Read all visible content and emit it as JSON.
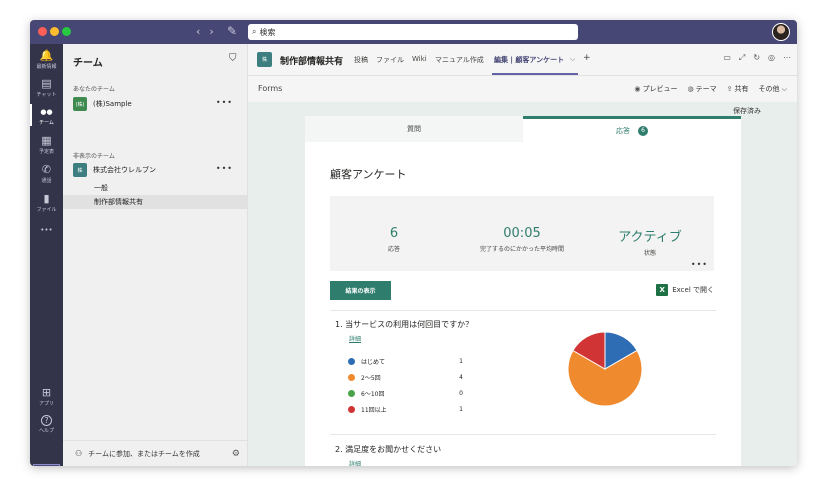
{
  "titlebar": {
    "search_text": "検索",
    "nav_back": "‹",
    "nav_forward": "›",
    "compose_icon": "✎"
  },
  "rail": [
    {
      "label": "最新情報",
      "icon": "bell-icon",
      "glyph": "🔔"
    },
    {
      "label": "チャット",
      "icon": "chat-icon",
      "glyph": "▤"
    },
    {
      "label": "チーム",
      "icon": "teams-icon",
      "glyph": "●●",
      "active": true
    },
    {
      "label": "予定表",
      "icon": "calendar-icon",
      "glyph": "▦"
    },
    {
      "label": "通話",
      "icon": "phone-icon",
      "glyph": "✆"
    },
    {
      "label": "ファイル",
      "icon": "file-icon",
      "glyph": "▮"
    },
    {
      "label": "",
      "icon": "more-icon",
      "glyph": "•••"
    },
    {
      "label": "アプリ",
      "icon": "apps-icon",
      "glyph": "⊞"
    },
    {
      "label": "ヘルプ",
      "icon": "help-icon",
      "glyph": "?"
    }
  ],
  "teams_panel": {
    "title": "チーム",
    "section_your_teams": "あなたのチーム",
    "section_hidden": "非表示のチーム",
    "teams": [
      {
        "logo_text": "(株)",
        "name": "(株)Sample",
        "color": "#3f8b4f"
      },
      {
        "logo_text": "株",
        "name": "株式会社ウレルブン",
        "color": "#3d7f80"
      }
    ],
    "channels": [
      {
        "name": "一般",
        "active": false
      },
      {
        "name": "制作部情報共有",
        "active": true
      }
    ],
    "join_text": "チームに参加、またはチームを作成"
  },
  "channel_header": {
    "logo_text": "株",
    "name": "制作部情報共有",
    "tabs": [
      "投稿",
      "ファイル",
      "Wiki",
      "マニュアル作成",
      "編集 | 顧客アンケート"
    ],
    "active_tab_index": 4,
    "add_tab": "+"
  },
  "forms_bar": {
    "label": "Forms",
    "actions": [
      {
        "icon": "eye-icon",
        "glyph": "◉",
        "label": "プレビュー"
      },
      {
        "icon": "palette-icon",
        "glyph": "◍",
        "label": "テーマ"
      },
      {
        "icon": "share-icon",
        "glyph": "⇪",
        "label": "共有"
      },
      {
        "icon": "chevron-down-icon",
        "glyph": "",
        "label": "その他 ⌵"
      }
    ],
    "saved_text": "保存済み"
  },
  "form": {
    "tab_questions": "質問",
    "tab_responses": "応答",
    "responses_badge": "6",
    "title": "顧客アンケート",
    "stats": [
      {
        "value": "6",
        "label": "応答"
      },
      {
        "value": "00:05",
        "label": "完了するのにかかった平均時間"
      },
      {
        "value": "アクティブ",
        "label": "状態"
      }
    ],
    "results_button": "結果の表示",
    "excel_text": "Excel で開く",
    "questions": [
      {
        "title": "1. 当サービスの利用は何回目ですか？",
        "detail": "詳細",
        "options": [
          {
            "label": "はじめて",
            "count": 1,
            "color": "#2e6db4"
          },
          {
            "label": "2〜5回",
            "count": 4,
            "color": "#f08a2e"
          },
          {
            "label": "6〜10回",
            "count": 0,
            "color": "#4aa34a"
          },
          {
            "label": "11回以上",
            "count": 1,
            "color": "#d03434"
          }
        ]
      },
      {
        "title": "2. 満足度をお聞かせください",
        "detail": "詳細"
      }
    ]
  },
  "chart_data": {
    "type": "pie",
    "categories": [
      "はじめて",
      "2〜5回",
      "6〜10回",
      "11回以上"
    ],
    "values": [
      1,
      4,
      0,
      1
    ],
    "colors": [
      "#2e6db4",
      "#f08a2e",
      "#4aa34a",
      "#d03434"
    ]
  }
}
